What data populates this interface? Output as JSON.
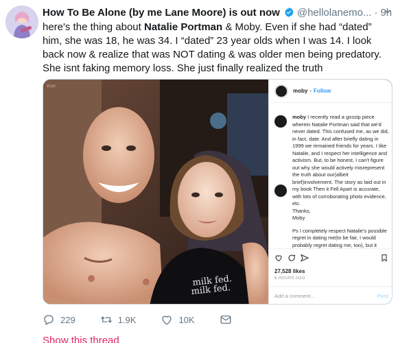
{
  "tweet": {
    "display_name": "How To Be Alone (by me Lane Moore) is out now",
    "handle": "@hellolanemo...",
    "separator": "·",
    "time": "9h",
    "text_part1": "here's the thing about ",
    "text_bold": "Natalie Portman",
    "text_part2": " & Moby. Even if she had “dated” him, she was 18, he was 34. I “dated” 23 year olds when I was 14. I look back now & realize that was NOT dating & was older men being predatory. She isnt faking memory loss. She just finally realized the truth"
  },
  "instagram": {
    "username": "moby",
    "dot": "•",
    "follow_label": "Follow",
    "caption_user": "moby",
    "caption_body": "I recently read a gossip piece wherein Natalie Portman said that we'd never dated. This confused me, as we did, in fact, date. And after briefly dating in 1999 we remained friends for years. I like Natalie, and I respect her intelligence and activism. But, to be honest, I can't figure out why she would actively misrepresent the truth about our(albeit brief)involvement. The story as laid out in my book Then it Fell Apart is accurate, with lots of corroborating photo evidence, etc.\nThanks,\nMoby",
    "ps_text": "Ps I completely respect Natalie's possible regret in dating me(to be fair, I would probably regret dating me, too), but it doesn't alter the actual facts of",
    "likes": "27,528 likes",
    "time_ago": "6 HOURS AGO",
    "comment_placeholder": "Add a comment...",
    "post_label": "Post",
    "shirt_text": "milk fed.",
    "sticker_text": "Foo"
  },
  "actions": {
    "replies": "229",
    "retweets": "1.9K",
    "likes": "10K"
  },
  "show_thread": "Show this thread",
  "colors": {
    "verified_blue": "#1da1f2",
    "link_red": "#e0245e",
    "meta_gray": "#657786",
    "ig_follow_blue": "#3897f0"
  }
}
